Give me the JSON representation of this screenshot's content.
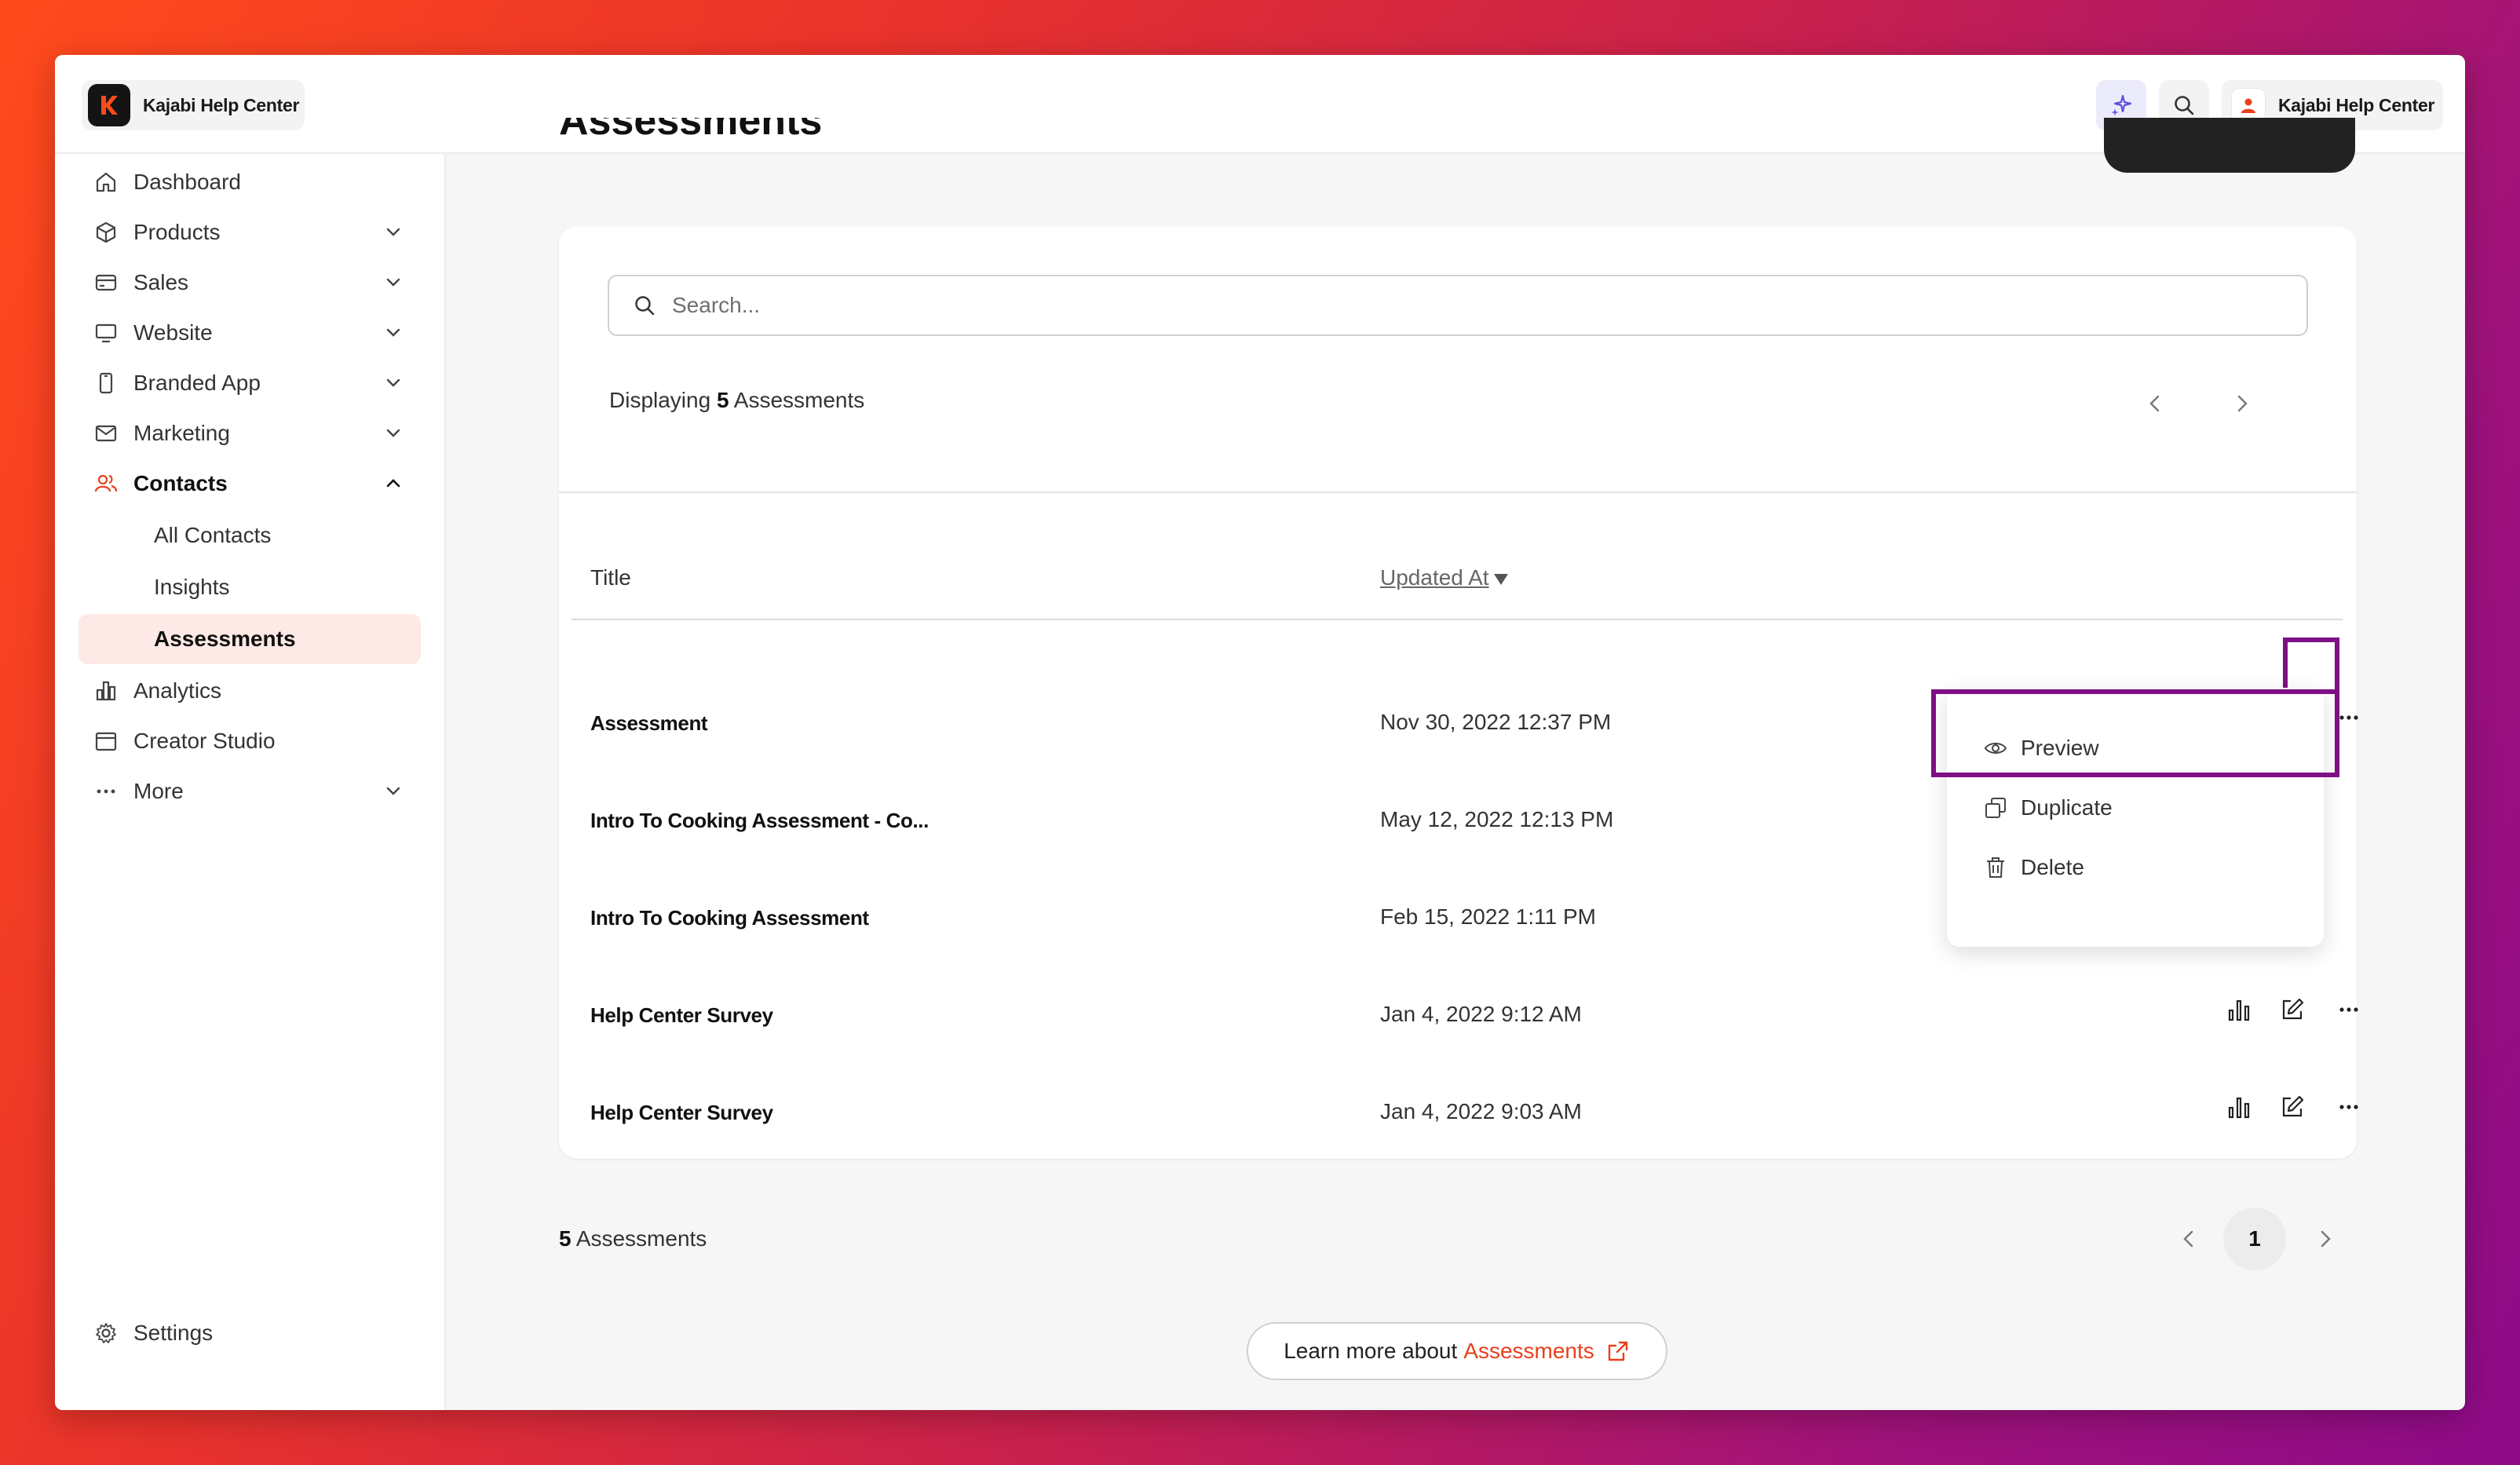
{
  "brand": {
    "name": "Kajabi Help Center"
  },
  "account": {
    "name": "Kajabi Help Center"
  },
  "sidebar": {
    "items": [
      {
        "label": "Dashboard",
        "icon": "home-icon"
      },
      {
        "label": "Products",
        "icon": "box-icon"
      },
      {
        "label": "Sales",
        "icon": "credit-card-icon"
      },
      {
        "label": "Website",
        "icon": "monitor-icon"
      },
      {
        "label": "Branded App",
        "icon": "phone-icon"
      },
      {
        "label": "Marketing",
        "icon": "mail-icon"
      },
      {
        "label": "Contacts",
        "icon": "users-icon"
      },
      {
        "label": "Analytics",
        "icon": "bar-chart-icon"
      },
      {
        "label": "Creator Studio",
        "icon": "calendar-icon"
      },
      {
        "label": "More",
        "icon": "ellipsis-icon"
      }
    ],
    "contacts_sub": [
      "All Contacts",
      "Insights",
      "Assessments"
    ],
    "settings_label": "Settings"
  },
  "page": {
    "title": "Assessments"
  },
  "search": {
    "placeholder": "Search..."
  },
  "summary": {
    "prefix": "Displaying",
    "count": "5",
    "suffix": "Assessments"
  },
  "table": {
    "columns": [
      "Title",
      "Updated At"
    ],
    "rows": [
      {
        "title": "Assessment",
        "updated": "Nov 30, 2022 12:37 PM"
      },
      {
        "title": "Intro To Cooking Assessment - Co...",
        "updated": "May 12, 2022 12:13 PM"
      },
      {
        "title": "Intro To Cooking Assessment",
        "updated": "Feb 15, 2022 1:11 PM"
      },
      {
        "title": "Help Center Survey",
        "updated": "Jan 4, 2022 9:12 AM"
      },
      {
        "title": "Help Center Survey",
        "updated": "Jan 4, 2022 9:03 AM"
      }
    ]
  },
  "menu": {
    "items": [
      "Preview",
      "Duplicate",
      "Delete"
    ]
  },
  "footer": {
    "count": "5",
    "count_label": "Assessments",
    "current_page": "1"
  },
  "learn_more": {
    "text": "Learn more about",
    "link": "Assessments"
  },
  "colors": {
    "accent": "#e8401c",
    "highlight": "#7f0f86",
    "ai": "#5b4de0"
  }
}
